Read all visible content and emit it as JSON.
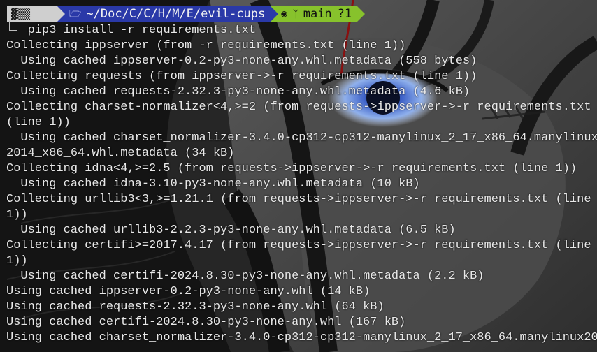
{
  "prompt": {
    "os_icon": "▓▒▒ ",
    "folder_icon": "folder-icon",
    "path": "~/Doc/C/C/H/M/E/evil-cups",
    "github_icon": "github-icon",
    "branch_icon": "branch-icon",
    "branch": "main",
    "status": "?1",
    "colors": {
      "os_segment": "#cfcfcf",
      "dir_segment": "#2a39a8",
      "git_segment": "#87c22c"
    }
  },
  "terminal": {
    "command": "pip3 install -r requirements.txt",
    "lines": [
      "Collecting ippserver (from -r requirements.txt (line 1))",
      "  Using cached ippserver-0.2-py3-none-any.whl.metadata (558 bytes)",
      "Collecting requests (from ippserver->-r requirements.txt (line 1))",
      "  Using cached requests-2.32.3-py3-none-any.whl.metadata (4.6 kB)",
      "Collecting charset-normalizer<4,>=2 (from requests->ippserver->-r requirements.txt",
      "(line 1))",
      "  Using cached charset_normalizer-3.4.0-cp312-cp312-manylinux_2_17_x86_64.manylinux",
      "2014_x86_64.whl.metadata (34 kB)",
      "Collecting idna<4,>=2.5 (from requests->ippserver->-r requirements.txt (line 1))",
      "  Using cached idna-3.10-py3-none-any.whl.metadata (10 kB)",
      "Collecting urllib3<3,>=1.21.1 (from requests->ippserver->-r requirements.txt (line",
      "1))",
      "  Using cached urllib3-2.2.3-py3-none-any.whl.metadata (6.5 kB)",
      "Collecting certifi>=2017.4.17 (from requests->ippserver->-r requirements.txt (line",
      "1))",
      "  Using cached certifi-2024.8.30-py3-none-any.whl.metadata (2.2 kB)",
      "Using cached ippserver-0.2-py3-none-any.whl (14 kB)",
      "Using cached requests-2.32.3-py3-none-any.whl (64 kB)",
      "Using cached certifi-2024.8.30-py3-none-any.whl (167 kB)",
      "Using cached charset_normalizer-3.4.0-cp312-cp312-manylinux_2_17_x86_64.manylinux20"
    ]
  }
}
